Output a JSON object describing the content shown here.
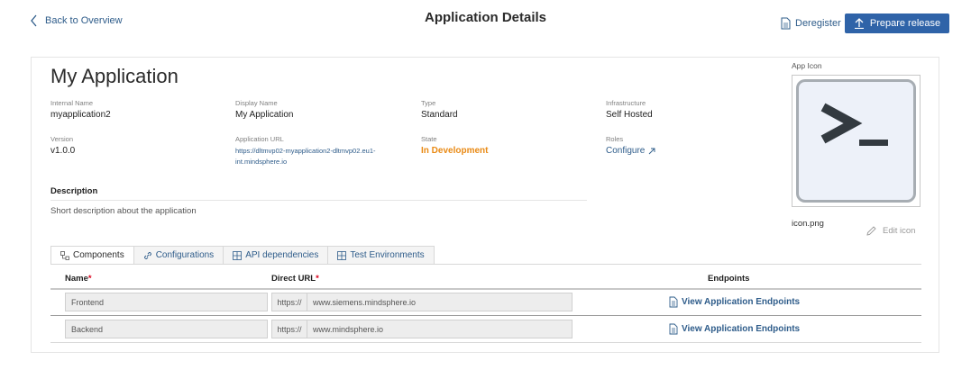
{
  "header": {
    "back_label": "Back to Overview",
    "title": "Application Details",
    "deregister_label": "Deregister",
    "prepare_release_label": "Prepare release"
  },
  "app": {
    "name": "My Application",
    "internal_name_label": "Internal Name",
    "internal_name": "myapplication2",
    "display_name_label": "Display Name",
    "display_name": "My Application",
    "type_label": "Type",
    "type": "Standard",
    "infrastructure_label": "Infrastructure",
    "infrastructure": "Self Hosted",
    "version_label": "Version",
    "version": "v1.0.0",
    "url_label": "Application URL",
    "url": "https://dltmvp02-myapplication2-dltmvp02.eu1-int.mindsphere.io",
    "state_label": "State",
    "state": "In Development",
    "state_color": "#e98a15",
    "roles_label": "Roles",
    "roles_action": "Configure",
    "description_heading": "Description",
    "description": "Short description about the application"
  },
  "icon_panel": {
    "label": "App Icon",
    "filename": "icon.png",
    "edit_label": "Edit icon",
    "icon": "terminal-prompt-icon"
  },
  "tabs": [
    {
      "label": "Components",
      "icon": "components-icon",
      "active": true
    },
    {
      "label": "Configurations",
      "icon": "link-icon",
      "active": false
    },
    {
      "label": "API dependencies",
      "icon": "grid-icon",
      "active": false
    },
    {
      "label": "Test Environments",
      "icon": "grid-icon",
      "active": false
    }
  ],
  "table": {
    "columns": {
      "name": "Name",
      "direct_url": "Direct URL",
      "endpoints": "Endpoints",
      "required_mark": "*"
    },
    "rows": [
      {
        "name": "Frontend",
        "prefix": "https://",
        "url": "www.siemens.mindsphere.io",
        "endpoint_label": "View Application Endpoints"
      },
      {
        "name": "Backend",
        "prefix": "https://",
        "url": "www.mindsphere.io",
        "endpoint_label": "View Application Endpoints"
      }
    ]
  },
  "colors": {
    "accent": "#2f63a8",
    "link": "#2e5c8a",
    "required": "#d9001b"
  }
}
